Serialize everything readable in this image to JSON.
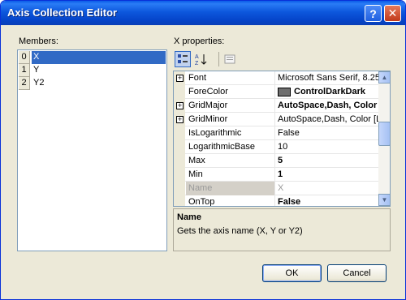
{
  "window": {
    "title": "Axis Collection Editor"
  },
  "titlebar_buttons": {
    "help": "?",
    "close": "✕"
  },
  "members": {
    "label": "Members:",
    "items": [
      {
        "index": "0",
        "name": "X",
        "selected": true
      },
      {
        "index": "1",
        "name": "Y"
      },
      {
        "index": "2",
        "name": "Y2"
      }
    ]
  },
  "properties": {
    "label": "X properties:",
    "toolbar": {
      "categorized_icon": "categorized-icon",
      "alphabetical_icon": "alphabetical-icon",
      "property-pages-icon": "property-pages-icon"
    },
    "rows": [
      {
        "name": "Font",
        "value": "Microsoft Sans Serif, 8.25",
        "expandable": true
      },
      {
        "name": "ForeColor",
        "value": "ControlDarkDark",
        "bold": true,
        "swatch": "#6e6e6e"
      },
      {
        "name": "GridMajor",
        "value": "AutoSpace,Dash, Color",
        "expandable": true,
        "bold": true
      },
      {
        "name": "GridMinor",
        "value": "AutoSpace,Dash, Color [L",
        "expandable": true
      },
      {
        "name": "IsLogarithmic",
        "value": "False"
      },
      {
        "name": "LogarithmicBase",
        "value": "10"
      },
      {
        "name": "Max",
        "value": "5",
        "bold": true
      },
      {
        "name": "Min",
        "value": "1",
        "bold": true
      },
      {
        "name": "Name",
        "value": "X",
        "disabled": true
      },
      {
        "name": "OnTop",
        "value": "False",
        "bold": true
      }
    ]
  },
  "description": {
    "title": "Name",
    "text": "Gets the axis name (X, Y or Y2)"
  },
  "buttons": {
    "ok": "OK",
    "cancel": "Cancel"
  }
}
